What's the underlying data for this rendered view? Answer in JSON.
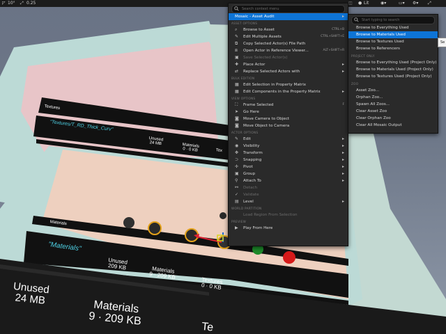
{
  "toolbar": {
    "angle_value": "10°",
    "scale_value": "0.25",
    "view_mode": "Lit"
  },
  "scene": {
    "upper_panel": {
      "title_small": "Textures",
      "asset_label": "\"Textures/T_RD_Thick_Curv\"",
      "unused_label": "Unused",
      "unused_value": "24 MB",
      "materials_label": "Materials",
      "materials_value": "0 · 0 KB",
      "textures_label": "Tex"
    },
    "lower_panel": {
      "title_small": "Materials",
      "asset_label": "\"Materials\"",
      "unused_label": "Unused",
      "unused_value": "209 KB",
      "materials_label": "Materials",
      "materials_value": "9 · 209 KB",
      "textures_label": "Textures",
      "textures_value": "0 · 0 KB"
    },
    "front_panel": {
      "unused_label": "Unused",
      "unused_value": "24 MB",
      "materials_label": "Materials",
      "materials_value": "9 · 209 KB",
      "textures_label": "Te"
    }
  },
  "main_menu": {
    "search_placeholder": "Search context menu",
    "highlighted_item": {
      "label": "Mosaic - Asset Audit",
      "arrow": "▸"
    },
    "sections": [
      {
        "header": "ASSET OPTIONS",
        "items": [
          {
            "label": "Browse to Asset",
            "shortcut": "CTRL+B",
            "icon": "browse-icon"
          },
          {
            "label": "Edit Multiple Assets",
            "shortcut": "CTRL+SHIFT+E",
            "icon": "edit-icon"
          },
          {
            "label": "Copy Selected Actor(s) File Path",
            "shortcut": "",
            "icon": "copy-icon"
          },
          {
            "label": "Open Actor in Reference Viewer...",
            "shortcut": "ALT+SHIFT+R",
            "icon": "reference-icon"
          },
          {
            "label": "Save Selected Actor(s)",
            "shortcut": "",
            "icon": "save-icon",
            "disabled": true
          },
          {
            "label": "Place Actor",
            "shortcut": "",
            "icon": "place-icon",
            "submenu": true
          },
          {
            "label": "Replace Selected Actors with",
            "shortcut": "",
            "icon": "replace-icon",
            "submenu": true
          }
        ]
      },
      {
        "header": "BULK EDITION",
        "items": [
          {
            "label": "Edit Selection in Property Matrix",
            "shortcut": "",
            "icon": "matrix-icon"
          },
          {
            "label": "Edit Components in the Property Matrix",
            "shortcut": "",
            "icon": "matrix-icon",
            "submenu": true
          }
        ]
      },
      {
        "header": "VIEW OPTIONS",
        "items": [
          {
            "label": "Frame Selected",
            "shortcut": "F",
            "icon": "frame-icon"
          },
          {
            "label": "Go Here",
            "shortcut": "",
            "icon": "go-here-icon"
          },
          {
            "label": "Move Camera to Object",
            "shortcut": "",
            "icon": "camera-icon"
          },
          {
            "label": "Move Object to Camera",
            "shortcut": "",
            "icon": "camera-icon"
          }
        ]
      },
      {
        "header": "ACTOR OPTIONS",
        "items": [
          {
            "label": "Edit",
            "shortcut": "",
            "icon": "edit-icon",
            "submenu": true
          },
          {
            "label": "Visibility",
            "shortcut": "",
            "icon": "visibility-icon",
            "submenu": true
          },
          {
            "label": "Transform",
            "shortcut": "",
            "icon": "transform-icon",
            "submenu": true
          },
          {
            "label": "Snapping",
            "shortcut": "",
            "icon": "snapping-icon",
            "submenu": true
          },
          {
            "label": "Pivot",
            "shortcut": "",
            "icon": "pivot-icon",
            "submenu": true
          },
          {
            "label": "Group",
            "shortcut": "",
            "icon": "group-icon",
            "submenu": true
          },
          {
            "label": "Attach To",
            "shortcut": "",
            "icon": "attach-icon",
            "submenu": true
          },
          {
            "label": "Detach",
            "shortcut": "",
            "icon": "detach-icon",
            "disabled": true
          },
          {
            "label": "Validate",
            "shortcut": "",
            "icon": "validate-icon",
            "disabled": true
          },
          {
            "label": "Level",
            "shortcut": "",
            "icon": "level-icon",
            "submenu": true
          }
        ]
      },
      {
        "header": "WORLD PARTITION",
        "items": [
          {
            "label": "Load Region From Selection",
            "shortcut": "",
            "icon": "",
            "disabled": true
          }
        ]
      },
      {
        "header": "PREVIEW",
        "items": [
          {
            "label": "Play From Here",
            "shortcut": "",
            "icon": "play-icon"
          }
        ]
      }
    ]
  },
  "sub_menu": {
    "search_placeholder": "Start typing to search",
    "sections": [
      {
        "header": "",
        "items": [
          {
            "label": "Browse to Everything Used"
          },
          {
            "label": "Browse to Materials Used",
            "highlighted": true
          },
          {
            "label": "Browse to Textures Used"
          },
          {
            "label": "Browse to Referencers"
          }
        ]
      },
      {
        "header": "PROJECT ONLY",
        "items": [
          {
            "label": "Browse to Everything Used (Project Only)"
          },
          {
            "label": "Browse to Materials Used (Project Only)"
          },
          {
            "label": "Browse to Textures Used (Project Only)"
          }
        ]
      },
      {
        "header": "ZOO",
        "items": [
          {
            "label": "Asset Zoo..."
          },
          {
            "label": "Orphan Zoo..."
          },
          {
            "label": "Spawn All Zoos..."
          },
          {
            "label": "Clear Asset Zoo"
          },
          {
            "label": "Clear Orphan Zoo"
          },
          {
            "label": "Clear All Mosaic Output"
          }
        ]
      }
    ]
  },
  "tooltip": {
    "text": "Se"
  },
  "colors": {
    "highlight": "#0e74d6",
    "menu_bg": "#2a2a2a",
    "cyan_label": "#4ed2e6"
  }
}
